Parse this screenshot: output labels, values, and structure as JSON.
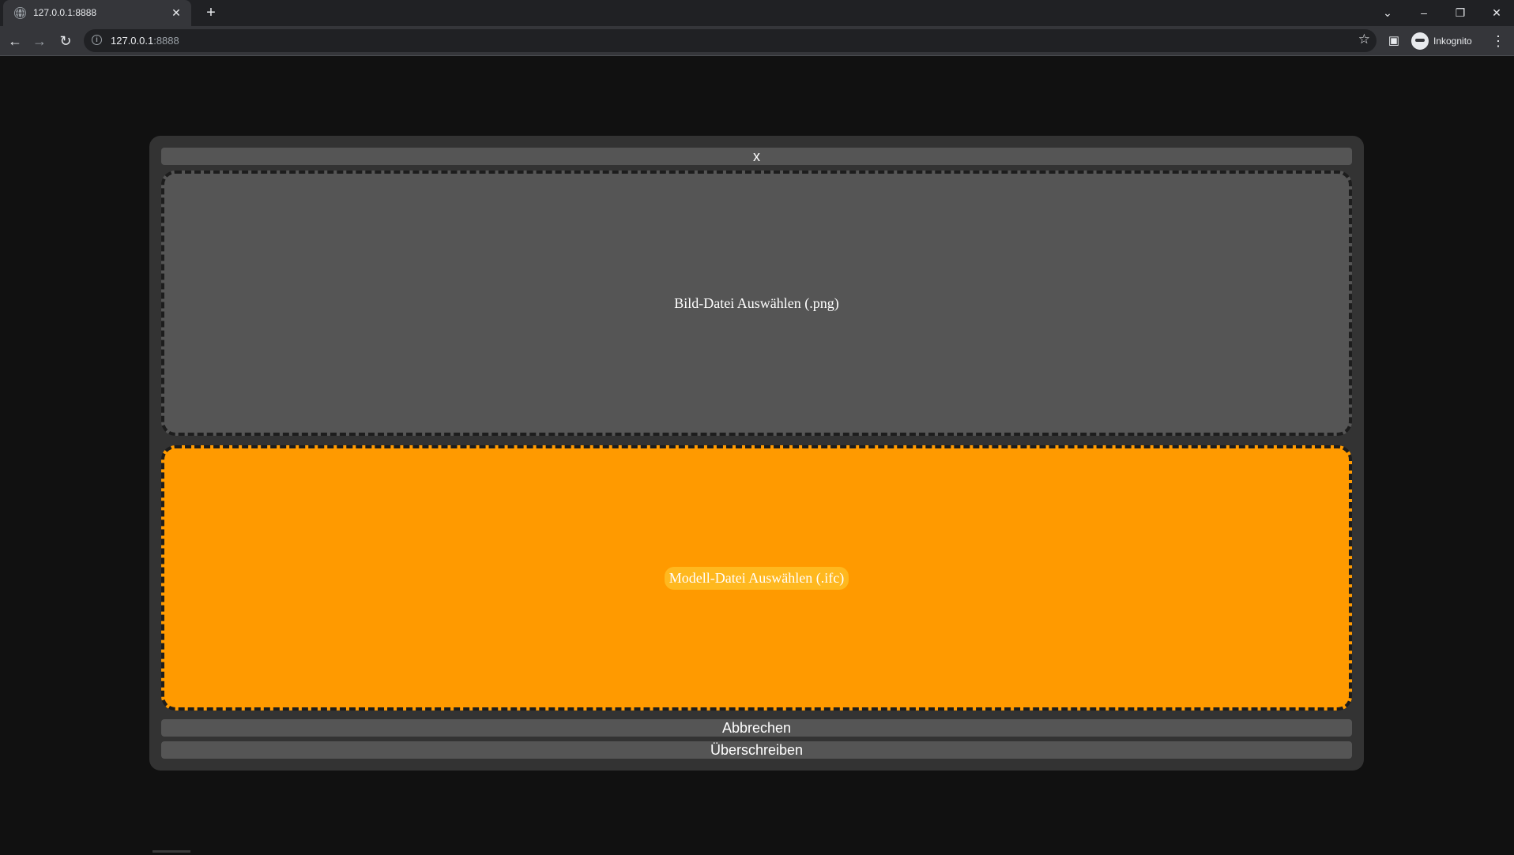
{
  "browser": {
    "tab_title": "127.0.0.1:8888",
    "tab_close": "✕",
    "new_tab": "+",
    "url_host": "127.0.0.1",
    "url_port": ":8888",
    "profile_label": "Inkognito",
    "controls": {
      "minimize": "–",
      "restore": "❐",
      "close": "✕",
      "tab_search": "⌄"
    },
    "nav": {
      "back": "←",
      "forward": "→",
      "reload": "↻",
      "star": "☆",
      "side_panel": "▣",
      "menu": "⋮"
    }
  },
  "dialog": {
    "close_label": "x",
    "png_drop_label": "Bild-Datei Auswählen (.png)",
    "ifc_drop_label": "Modell-Datei Auswählen (.ifc)",
    "cancel_label": "Abbrechen",
    "overwrite_label": "Überschreiben"
  },
  "colors": {
    "page_background": "#111111",
    "dialog_background": "#333333",
    "button_background": "#555555",
    "ifc_drop_active": "#ff9a00"
  }
}
